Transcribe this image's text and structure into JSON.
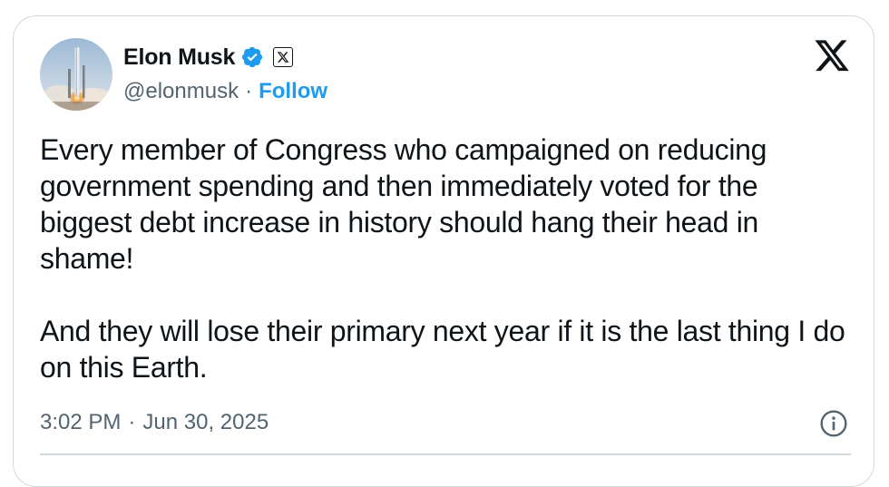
{
  "author": {
    "display_name": "Elon Musk",
    "handle": "@elonmusk",
    "separator": "·",
    "follow_label": "Follow",
    "verified_icon": "verified-badge-icon",
    "affiliation_icon": "x-affiliate-badge-icon",
    "avatar_icon": "rocket-avatar"
  },
  "platform": {
    "logo_icon": "x-logo-icon"
  },
  "tweet": {
    "paragraphs": [
      "Every member of Congress who campaigned on reducing government spending and then immediately voted for the biggest debt increase in history should hang their head in shame!",
      "And they will lose their primary next year if it is the last thing I do on this Earth."
    ],
    "time": "3:02 PM",
    "separator": "·",
    "date": "Jun 30, 2025",
    "info_icon": "info-icon"
  },
  "colors": {
    "text": "#0f1419",
    "secondary": "#536471",
    "accent": "#1d9bf0",
    "border": "#cfd9de"
  }
}
